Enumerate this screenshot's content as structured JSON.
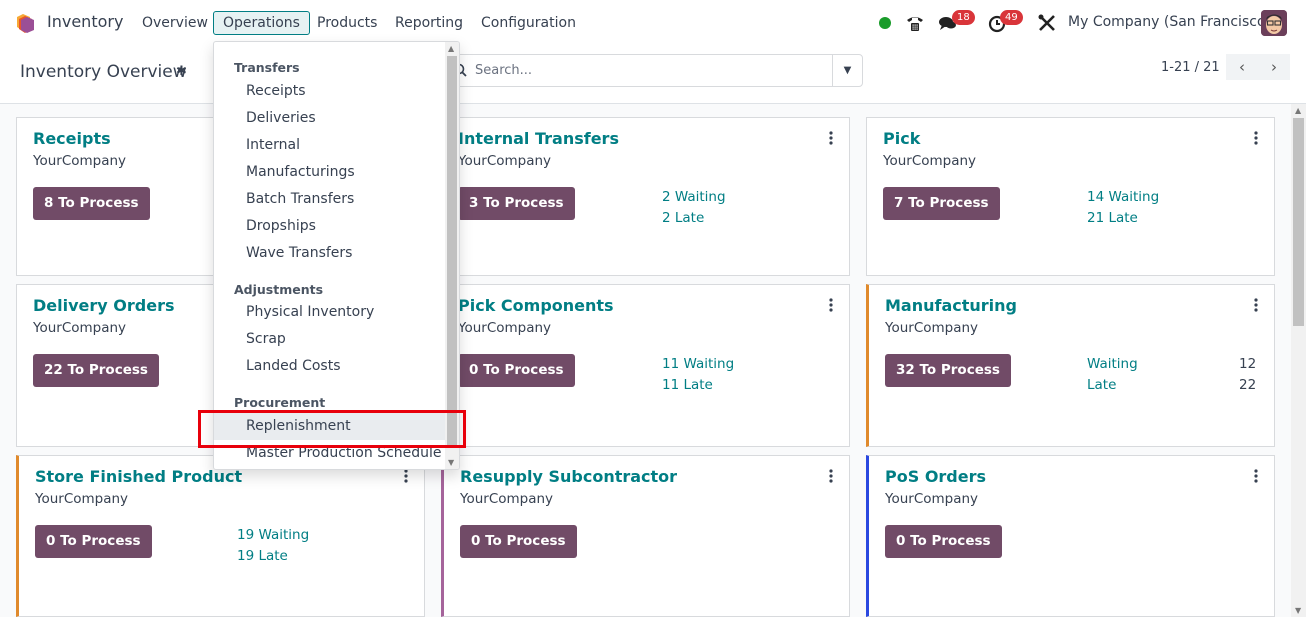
{
  "navbar": {
    "app_name": "Inventory",
    "menu": [
      {
        "label": "Overview"
      },
      {
        "label": "Operations",
        "active": true
      },
      {
        "label": "Products"
      },
      {
        "label": "Reporting"
      },
      {
        "label": "Configuration"
      }
    ],
    "systray": {
      "status": "online",
      "status_color": "#1a9c2b",
      "messages_badge": "18",
      "activities_badge": "49",
      "company": "My Company (San Francisco)"
    }
  },
  "control_panel": {
    "title": "Inventory Overview",
    "search_placeholder": "Search...",
    "pager": "1-21 / 21",
    "prev_icon": "‹",
    "next_icon": "›"
  },
  "dropdown": {
    "sections": [
      {
        "header": "Transfers",
        "items": [
          "Receipts",
          "Deliveries",
          "Internal",
          "Manufacturings",
          "Batch Transfers",
          "Dropships",
          "Wave Transfers"
        ]
      },
      {
        "header": "Adjustments",
        "items": [
          "Physical Inventory",
          "Scrap",
          "Landed Costs"
        ]
      },
      {
        "header": "Procurement",
        "items": [
          "Replenishment",
          "Master Production Schedule"
        ]
      }
    ],
    "highlighted_item": "Replenishment"
  },
  "cards": [
    {
      "title": "Receipts",
      "company": "YourCompany",
      "process": "8 To Process"
    },
    {
      "title": "Internal Transfers",
      "company": "YourCompany",
      "process": "3 To Process",
      "waiting": "2 Waiting",
      "late": "2 Late"
    },
    {
      "title": "Pick",
      "company": "YourCompany",
      "process": "7 To Process",
      "waiting": "14 Waiting",
      "late": "21 Late"
    },
    {
      "title": "Delivery Orders",
      "company": "YourCompany",
      "process": "22 To Process"
    },
    {
      "title": "Pick Components",
      "company": "YourCompany",
      "process": "0 To Process",
      "waiting": "11 Waiting",
      "late": "11 Late"
    },
    {
      "title": "Manufacturing",
      "company": "YourCompany",
      "process": "32 To Process",
      "waiting_label": "Waiting",
      "waiting_count": "12",
      "late_label": "Late",
      "late_count": "22",
      "accent": "#e08a2c"
    },
    {
      "title": "Store Finished Product",
      "company": "YourCompany",
      "process": "0 To Process",
      "waiting": "19 Waiting",
      "late": "19 Late",
      "accent": "#e08a2c"
    },
    {
      "title": "Resupply Subcontractor",
      "company": "YourCompany",
      "process": "0 To Process",
      "accent": "#a5649b"
    },
    {
      "title": "PoS Orders",
      "company": "YourCompany",
      "process": "0 To Process",
      "accent": "#2b48e0"
    }
  ],
  "colors": {
    "brand": "#714b67",
    "link": "#017e84",
    "badge": "#d9353a",
    "highlight": "#e8000b"
  }
}
